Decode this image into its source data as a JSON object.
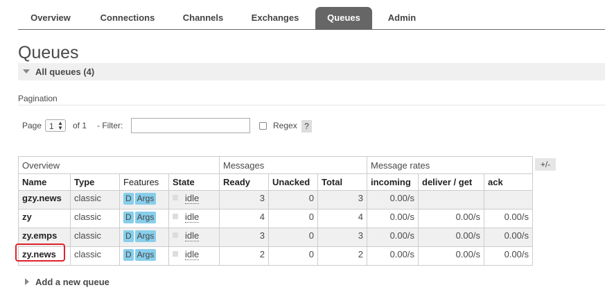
{
  "nav": {
    "tabs": [
      {
        "label": "Overview",
        "active": false
      },
      {
        "label": "Connections",
        "active": false
      },
      {
        "label": "Channels",
        "active": false
      },
      {
        "label": "Exchanges",
        "active": false
      },
      {
        "label": "Queues",
        "active": true
      },
      {
        "label": "Admin",
        "active": false
      }
    ]
  },
  "page_title": "Queues",
  "section": {
    "title": "All queues (4)"
  },
  "pagination": {
    "heading": "Pagination",
    "page_label": "Page",
    "page_value": "1",
    "of_label": "of 1",
    "filter_label": "- Filter:",
    "filter_value": "",
    "regex_label": "Regex",
    "regex_checked": false,
    "help_label": "?"
  },
  "table": {
    "groups": [
      "Overview",
      "Messages",
      "Message rates"
    ],
    "columns": [
      "Name",
      "Type",
      "Features",
      "State",
      "Ready",
      "Unacked",
      "Total",
      "incoming",
      "deliver / get",
      "ack"
    ],
    "toggle_label": "+/-",
    "rows": [
      {
        "name": "gzy.news",
        "type": "classic",
        "features": [
          "D",
          "Args"
        ],
        "state": "idle",
        "ready": "3",
        "unacked": "0",
        "total": "3",
        "incoming": "0.00/s",
        "deliver_get": "",
        "ack": ""
      },
      {
        "name": "zy",
        "type": "classic",
        "features": [
          "D",
          "Args"
        ],
        "state": "idle",
        "ready": "4",
        "unacked": "0",
        "total": "4",
        "incoming": "0.00/s",
        "deliver_get": "0.00/s",
        "ack": "0.00/s"
      },
      {
        "name": "zy.emps",
        "type": "classic",
        "features": [
          "D",
          "Args"
        ],
        "state": "idle",
        "ready": "3",
        "unacked": "0",
        "total": "3",
        "incoming": "0.00/s",
        "deliver_get": "0.00/s",
        "ack": "0.00/s"
      },
      {
        "name": "zy.news",
        "type": "classic",
        "features": [
          "D",
          "Args"
        ],
        "state": "idle",
        "ready": "2",
        "unacked": "0",
        "total": "2",
        "incoming": "0.00/s",
        "deliver_get": "0.00/s",
        "ack": "0.00/s"
      }
    ]
  },
  "add_queue": {
    "label": "Add a new queue"
  },
  "colors": {
    "active_tab": "#666666",
    "badge": "#87ceeb",
    "highlight": "#e0202a"
  }
}
